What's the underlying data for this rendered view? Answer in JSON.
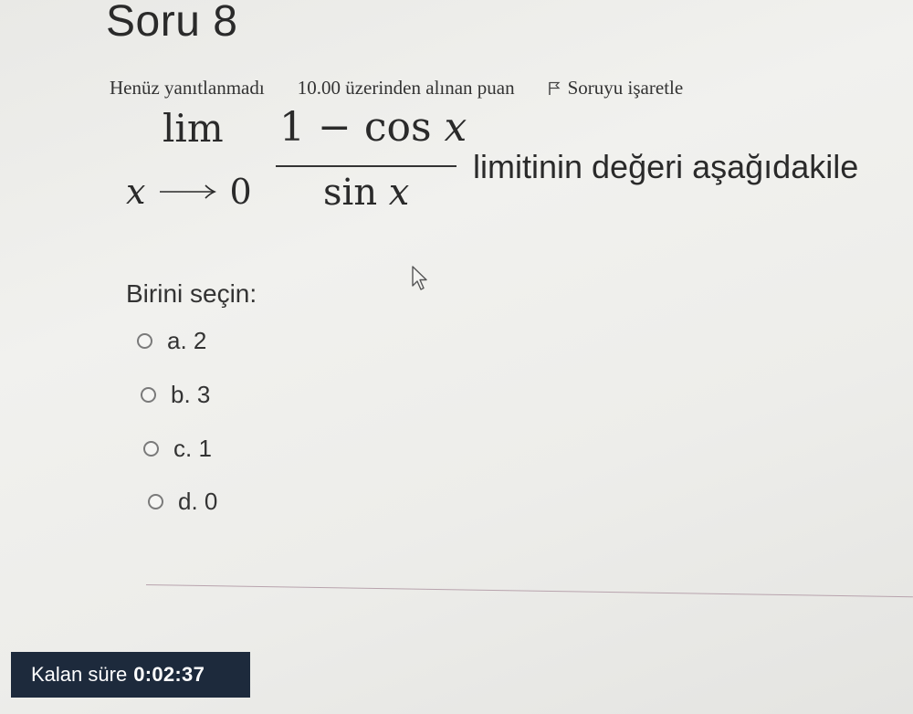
{
  "question": {
    "title": "Soru 8",
    "state": "Henüz yanıtlanmadı",
    "grade": "10.00 üzerinden alınan puan",
    "flag_label": "Soruyu işaretle",
    "formula": {
      "lim": "lim",
      "sub_var": "x",
      "sub_target": "0",
      "numerator_lead": "1 − cos ",
      "numerator_var": "x",
      "denominator_lead": "sin ",
      "denominator_var": "x"
    },
    "text": "limitinin değeri aşağıdakile"
  },
  "answers": {
    "prompt": "Birini seçin:",
    "options": [
      {
        "label": "a. 2",
        "selected": false
      },
      {
        "label": "b. 3",
        "selected": false
      },
      {
        "label": "c. 1",
        "selected": false
      },
      {
        "label": "d. 0",
        "selected": false
      }
    ]
  },
  "timer": {
    "label": "Kalan süre",
    "value": "0:02:37"
  },
  "colors": {
    "timer_background": "#1d2a3c",
    "separator": "#b8a3ad"
  }
}
